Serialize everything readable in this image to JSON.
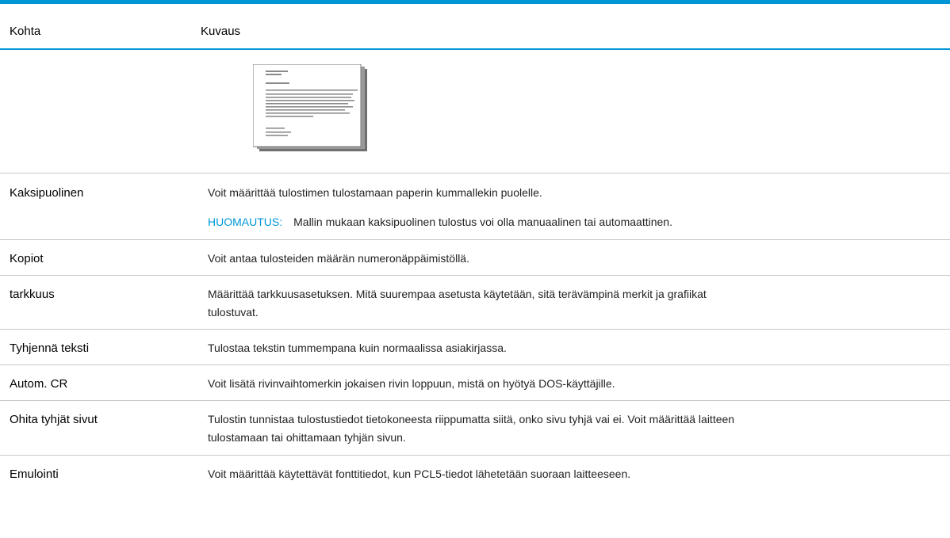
{
  "table": {
    "header": {
      "col1": "Kohta",
      "col2": "Kuvaus"
    },
    "illustration": {
      "icon": "document-page-icon"
    },
    "rows": [
      {
        "label": "Kaksipuolinen",
        "description": "Voit määrittää tulostimen tulostamaan paperin kummallekin puolelle.",
        "note_label": "HUOMAUTUS:",
        "note_text": "Mallin mukaan kaksipuolinen tulostus voi olla manuaalinen tai automaattinen."
      },
      {
        "label": "Kopiot",
        "description": "Voit antaa tulosteiden määrän numeronäppäimistöllä."
      },
      {
        "label": "tarkkuus",
        "description": "Määrittää tarkkuusasetuksen. Mitä suurempaa asetusta käytetään, sitä terävämpinä merkit ja grafiikat tulostuvat."
      },
      {
        "label": "Tyhjennä teksti",
        "description": "Tulostaa tekstin tummempana kuin normaalissa asiakirjassa."
      },
      {
        "label": "Autom. CR",
        "description": "Voit lisätä rivinvaihtomerkin jokaisen rivin loppuun, mistä on hyötyä DOS-käyttäjille."
      },
      {
        "label": "Ohita tyhjät sivut",
        "description": "Tulostin tunnistaa tulostustiedot tietokoneesta riippumatta siitä, onko sivu tyhjä vai ei. Voit määrittää laitteen tulostamaan tai ohittamaan tyhjän sivun."
      },
      {
        "label": "Emulointi",
        "description": "Voit määrittää käytettävät fonttitiedot, kun PCL5-tiedot lähetetään suoraan laitteeseen."
      }
    ]
  }
}
